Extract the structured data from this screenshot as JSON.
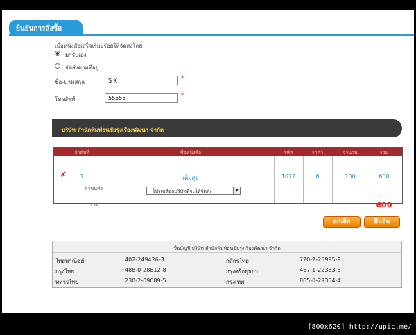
{
  "header": {
    "title": "ยืนยันการสั่งซื้อ"
  },
  "delivery": {
    "prompt": "เมื่อหนังสือเสร็จเรียบร้อยให้จัดส่งโดย",
    "options": [
      "มารับเอง",
      "จัดส่งตามที่อยู่"
    ],
    "selected_index": 0
  },
  "form": {
    "name_label": "ชื่อ-นามสกุล",
    "name_value": "S K",
    "phone_label": "โทรศัพท์",
    "phone_value": "55555",
    "required_mark": "*"
  },
  "company": {
    "name": "บริษัท สำนักพิมพ์ธนชัยรุ่งเรืองพัฒนา จำกัด"
  },
  "order": {
    "columns": [
      "ลำดับที่",
      "ชื่อหนังสือ",
      "รหัส",
      "ราคา",
      "จำนวน",
      "รวม"
    ],
    "rows": [
      {
        "no": "1",
        "title": "เต็มสุข",
        "code": "1072",
        "price": "6",
        "qty": "100",
        "total": "600"
      }
    ],
    "shipping_label": "ค่าขนส่ง",
    "shipping_select": "- โปรดเลือกบริษัทที่จะให้จัดส่ง -",
    "sum_label": "รวม",
    "grand_total": "600",
    "delete_symbol": "✘"
  },
  "buttons": {
    "cancel": "ยกเลิก",
    "confirm": "ยืนยัน"
  },
  "bank": {
    "title": "ชื่อบัญชี บริษัท สำนักพิมพ์ธนชัยรุ่งเรืองพัฒนา จำกัด",
    "accounts": [
      {
        "bank": "ไทยพาณิชย์",
        "number": "402-249426-3"
      },
      {
        "bank": "กสิกรไทย",
        "number": "720-2-25995-9"
      },
      {
        "bank": "กรุงไทย",
        "number": "488-0-28812-8"
      },
      {
        "bank": "กรุงศรีอยุธยา",
        "number": "467-1-22383-3"
      },
      {
        "bank": "ทหารไทย",
        "number": "230-2-09089-5"
      },
      {
        "bank": "กรุงเทพ",
        "number": "865-0-29354-4"
      }
    ]
  },
  "watermark": "[800x620] http://upic.me/"
}
